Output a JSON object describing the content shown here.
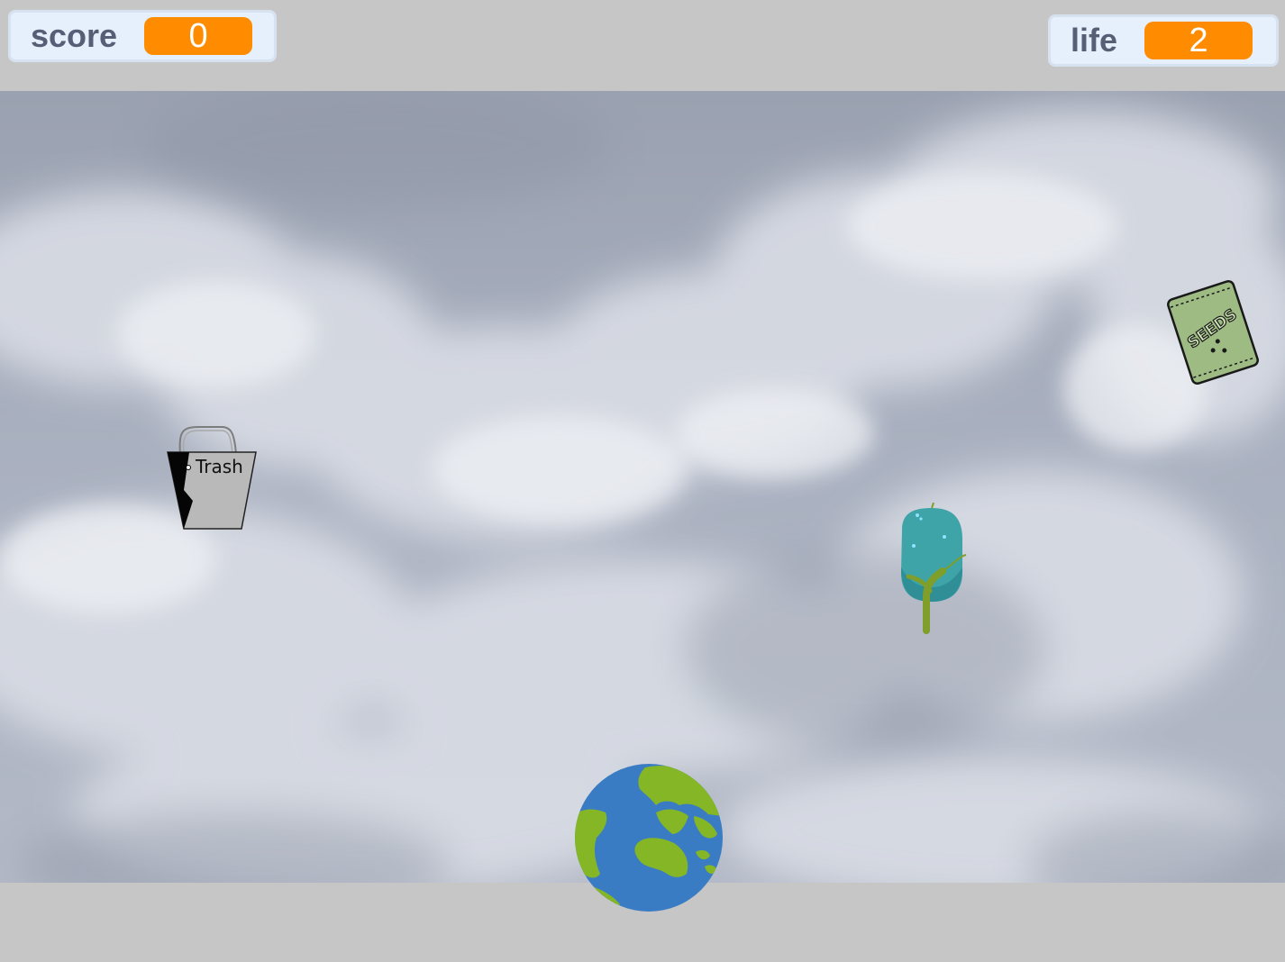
{
  "monitors": {
    "score": {
      "label": "score",
      "value": "0"
    },
    "life": {
      "label": "life",
      "value": "2"
    }
  },
  "sprites": {
    "trash": {
      "label": "Trash"
    },
    "seeds": {
      "label": "SEEDS"
    }
  },
  "colors": {
    "monitor_value_bg": "#ff8c00",
    "monitor_label": "#575e75",
    "monitor_bg": "#e6f0fc",
    "ocean": "#3a7cc4",
    "land": "#85b625",
    "tree_foliage": "#3ea4a8",
    "seeds_packet": "#9dbb82"
  },
  "icons": [
    "trash-bag-icon",
    "seeds-packet-icon",
    "tree-icon",
    "earth-globe-icon"
  ]
}
